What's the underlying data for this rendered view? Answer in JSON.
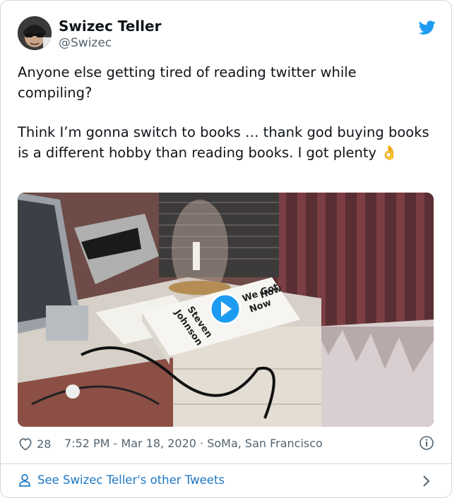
{
  "author": {
    "name": "Swizec Teller",
    "handle": "@Swizec",
    "avatar_icon": "user-avatar-photo"
  },
  "brand_icon": "twitter-bird-icon",
  "tweet": {
    "paragraph_1": "Anyone else getting tired of reading twitter while compiling?",
    "paragraph_2": "Think I’m gonna switch to books … thank god buying books is a different hobby than reading books. I got plenty 👌"
  },
  "media": {
    "type": "video",
    "play_icon": "play-icon",
    "book_lines": [
      "How",
      "We Got",
      "Now",
      "Steven",
      "Johnson"
    ]
  },
  "meta": {
    "like_count": "28",
    "timestamp": "7:52 PM - Mar 18, 2020",
    "location": " · SoMa, San Francisco"
  },
  "footer": {
    "link_label": "See Swizec Teller's other Tweets"
  },
  "colors": {
    "accent": "#1d9bf0",
    "link": "#1d77c3",
    "text": "#0f1419",
    "muted": "#536471",
    "border": "#cfd9de"
  }
}
